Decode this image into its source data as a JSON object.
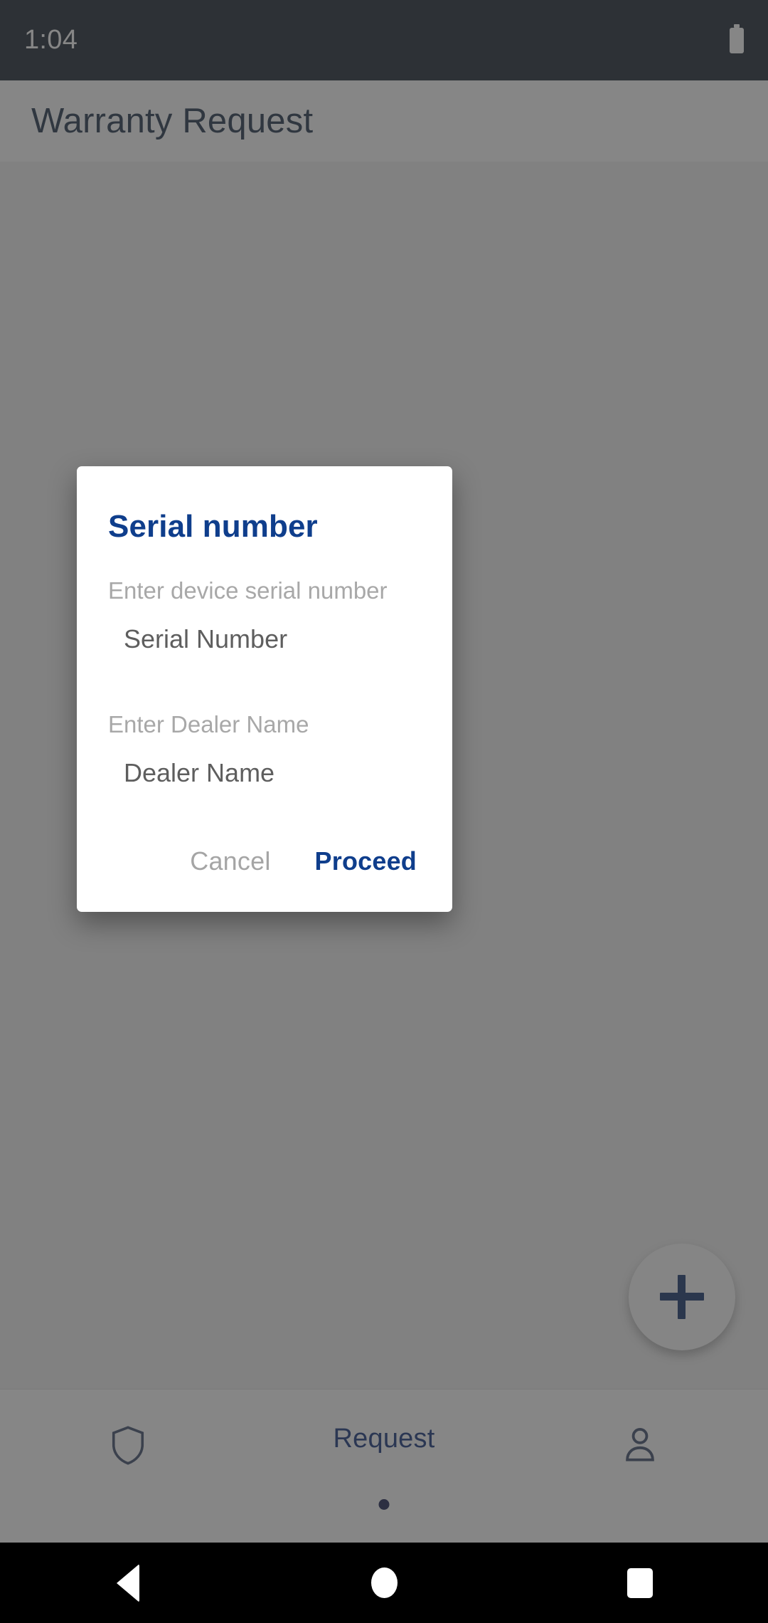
{
  "status_bar": {
    "time": "1:04",
    "battery_icon": "battery-full-icon"
  },
  "app_bar": {
    "title": "Warranty Request"
  },
  "fab": {
    "icon": "plus-icon",
    "label": ""
  },
  "bottom_nav": {
    "items": [
      {
        "label": "",
        "icon": "shield-icon",
        "selected": false
      },
      {
        "label": "Request",
        "icon": "",
        "selected": true
      },
      {
        "label": "",
        "icon": "person-icon",
        "selected": false
      }
    ],
    "indicator_dot": "page-indicator-dot"
  },
  "dialog": {
    "title": "Serial number",
    "fields": [
      {
        "label": "Enter device serial number",
        "placeholder": "Serial Number",
        "value": ""
      },
      {
        "label": "Enter Dealer Name",
        "placeholder": "Dealer Name",
        "value": ""
      }
    ],
    "cancel_label": "Cancel",
    "proceed_label": "Proceed"
  },
  "system_nav": {
    "back": "back-icon",
    "home": "home-icon",
    "recents": "recents-icon"
  },
  "colors": {
    "accent_blue": "#0f3e8c",
    "title_navy": "#1d3149",
    "nav_selected": "#11307a",
    "label_grey": "#a8a8a8",
    "input_grey": "#5e5e5e"
  }
}
